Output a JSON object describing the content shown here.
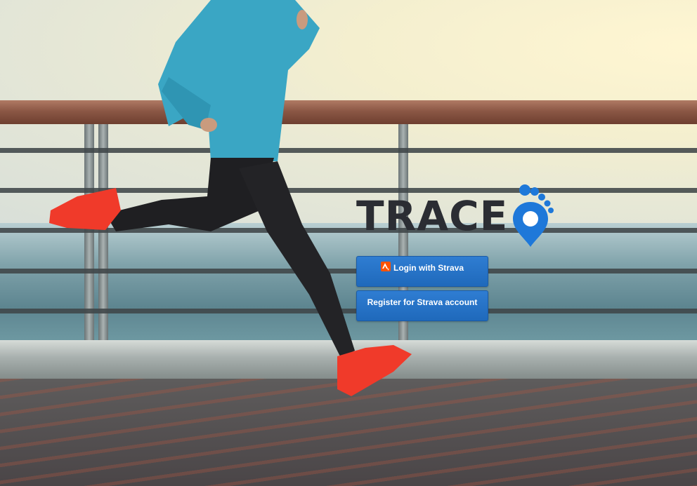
{
  "brand": {
    "name": "TRACE",
    "logo_icon": "footprint-pin-icon"
  },
  "buttons": {
    "login_label": "Login with Strava",
    "register_label": "Register for Strava account",
    "strava_icon": "strava-icon"
  },
  "colors": {
    "button_bg": "#2473c7",
    "brand_text": "#2b2d33",
    "logo_blue": "#1e78d9",
    "strava_orange": "#fc5200"
  }
}
